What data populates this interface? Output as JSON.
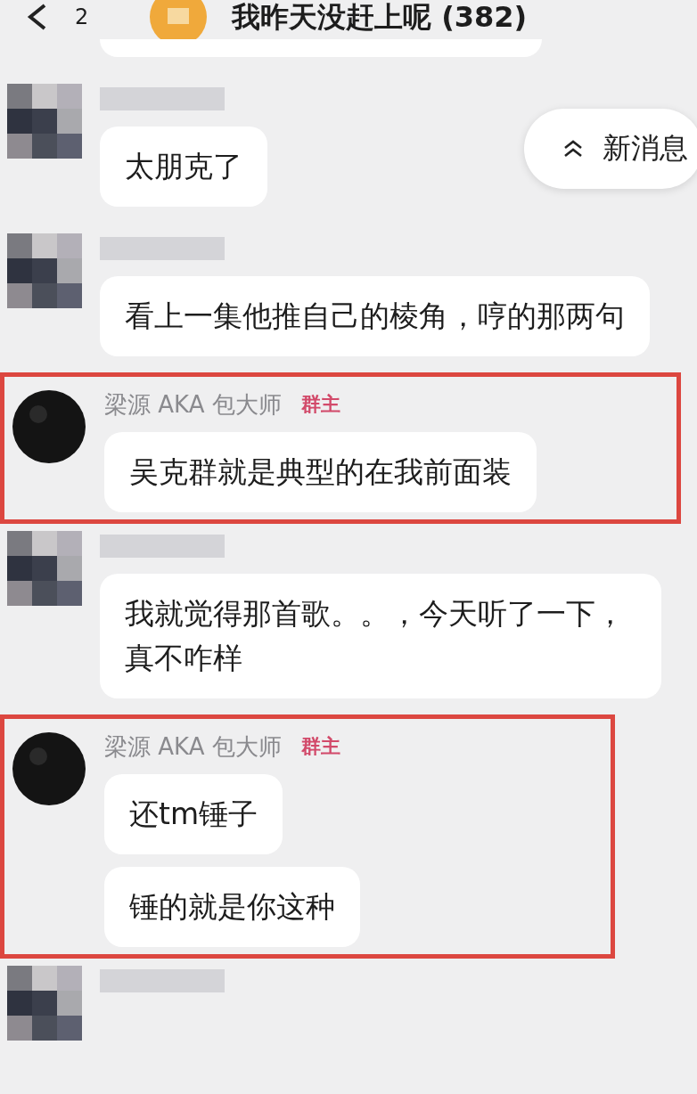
{
  "header": {
    "back_count": "2",
    "title": "我昨天没赶上呢 (382)"
  },
  "new_messages": {
    "label": "新消息"
  },
  "messages": [
    {
      "kind": "cut",
      "highlighted": false,
      "bubbles": [
        {
          "kind": "cut"
        }
      ]
    },
    {
      "kind": "mosaic",
      "highlighted": false,
      "bubbles": [
        {
          "kind": "text",
          "text": "太朋克了"
        }
      ]
    },
    {
      "kind": "mosaic",
      "highlighted": false,
      "bubbles": [
        {
          "kind": "text",
          "text": "看上一集他推自己的棱角，哼的那两句"
        }
      ]
    },
    {
      "kind": "round",
      "highlighted": true,
      "sender": "梁源 AKA 包大师",
      "badge": "群主",
      "bubbles": [
        {
          "kind": "text",
          "text": "吴克群就是典型的在我前面装"
        }
      ]
    },
    {
      "kind": "mosaic",
      "highlighted": false,
      "bubbles": [
        {
          "kind": "text",
          "text": "我就觉得那首歌。。，今天听了一下，真不咋样"
        }
      ]
    },
    {
      "kind": "round",
      "highlighted": true,
      "sender": "梁源 AKA 包大师",
      "badge": "群主",
      "bubbles": [
        {
          "kind": "text",
          "text": "还tm锤子"
        },
        {
          "kind": "text",
          "text": "锤的就是你这种"
        }
      ]
    },
    {
      "kind": "mosaic",
      "highlighted": false
    }
  ]
}
